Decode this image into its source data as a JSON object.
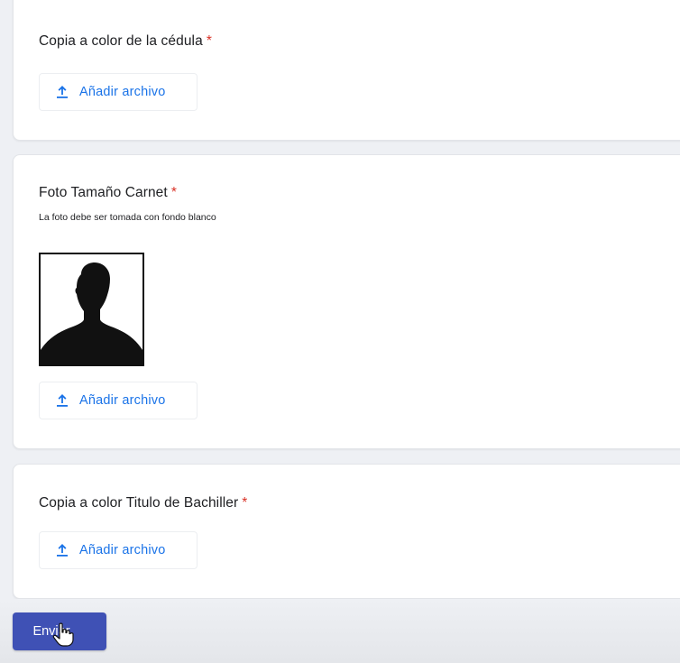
{
  "questions": [
    {
      "title": "Copia a color de la cédula",
      "required_mark": "*",
      "upload_label": "Añadir archivo"
    },
    {
      "title": "Foto Tamaño Carnet",
      "required_mark": "*",
      "description": "La foto debe ser tomada con fondo blanco",
      "upload_label": "Añadir archivo"
    },
    {
      "title": "Copia a color Titulo de Bachiller",
      "required_mark": "*",
      "upload_label": "Añadir archivo"
    }
  ],
  "submit": {
    "label": "Enviar"
  },
  "icons": {
    "upload": "upload-icon",
    "photo": "person-silhouette-image",
    "cursor": "hand-pointer-cursor"
  },
  "colors": {
    "accent_blue": "#1a73e8",
    "submit_bg": "#3f51b5",
    "required_red": "#d93025"
  }
}
